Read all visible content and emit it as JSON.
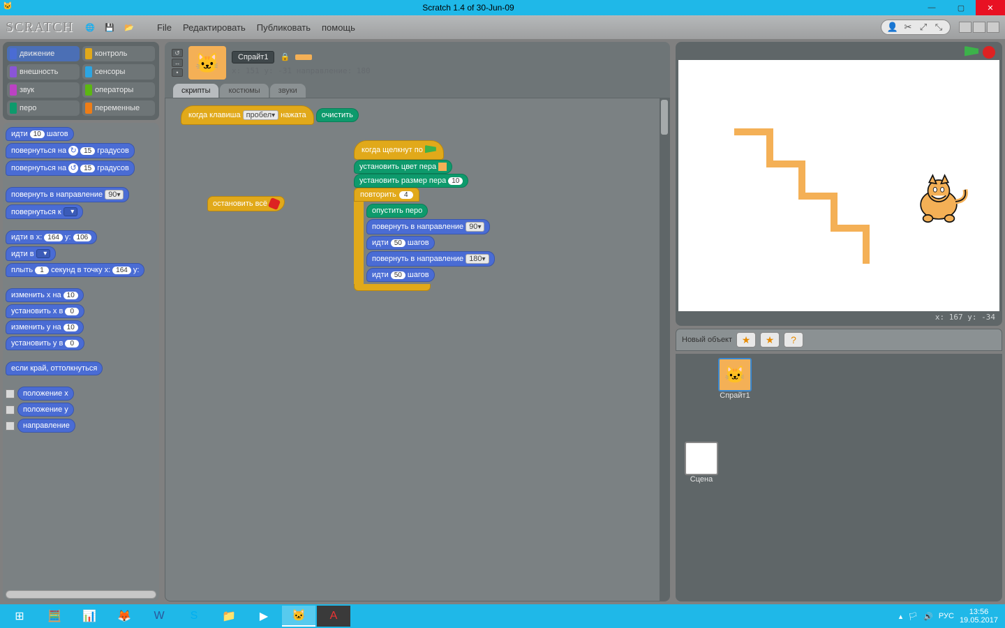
{
  "window": {
    "title": "Scratch 1.4 of 30-Jun-09"
  },
  "menu": {
    "logo": "SCRATCH",
    "items": {
      "file": "File",
      "edit": "Редактировать",
      "share": "Публиковать",
      "help": "помощь"
    }
  },
  "categories": {
    "motion": "движение",
    "looks": "внешность",
    "sound": "звук",
    "pen": "перо",
    "control": "контроль",
    "sensing": "сенсоры",
    "operators": "операторы",
    "variables": "переменные",
    "colors": {
      "motion": "#4a6cd4",
      "looks": "#8a55d7",
      "sound": "#bb42c3",
      "pen": "#0e9a6c",
      "control": "#e1a91a",
      "sensing": "#2ca5e2",
      "operators": "#5cb712",
      "variables": "#ee7d16"
    }
  },
  "palette": {
    "move": {
      "a": "идти",
      "n": "10",
      "b": "шагов"
    },
    "turnCW": {
      "a": "повернуться на",
      "n": "15",
      "b": "градусов"
    },
    "turnCCW": {
      "a": "повернуться на",
      "n": "15",
      "b": "градусов"
    },
    "point": {
      "a": "повернуть в направление",
      "n": "90"
    },
    "pointTowards": {
      "a": "повернуться к",
      "n": " "
    },
    "gotoXY": {
      "a": "идти в x:",
      "x": "164",
      "b": "y:",
      "y": "106"
    },
    "goto": {
      "a": "идти в",
      "n": " "
    },
    "glide": {
      "a": "плыть",
      "s": "1",
      "b": "секунд в точку x:",
      "x": "164",
      "c": "y:"
    },
    "changeX": {
      "a": "изменить x на",
      "n": "10"
    },
    "setX": {
      "a": "установить x в",
      "n": "0"
    },
    "changeY": {
      "a": "изменить y на",
      "n": "10"
    },
    "setY": {
      "a": "установить y в",
      "n": "0"
    },
    "bounce": "если край, оттолкнуться",
    "rep_xpos": "положение x",
    "rep_ypos": "положение y",
    "rep_dir": "направление"
  },
  "sprite": {
    "name": "Спрайт1",
    "info": "x: 151  y: -31  направление: 180",
    "tabs": {
      "scripts": "скрипты",
      "costumes": "костюмы",
      "sounds": "звуки"
    }
  },
  "scripts": {
    "s1": {
      "hat": {
        "a": "когда клавиша",
        "key": "пробел",
        "b": "нажата"
      },
      "clear": "очистить"
    },
    "s2": {
      "stopAll": "остановить всё"
    },
    "s3": {
      "hat": "когда щелкнут по",
      "setColor": "установить цвет пера",
      "setSize": {
        "a": "установить размер пера",
        "n": "10"
      },
      "repeat": {
        "a": "повторить",
        "n": "4"
      },
      "penDown": "опустить перо",
      "point1": {
        "a": "повернуть в направление",
        "n": "90"
      },
      "move1": {
        "a": "идти",
        "n": "50",
        "b": "шагов"
      },
      "point2": {
        "a": "повернуть в направление",
        "n": "180"
      },
      "move2": {
        "a": "идти",
        "n": "50",
        "b": "шагов"
      }
    }
  },
  "stage": {
    "xy": "x: 167   y: -34"
  },
  "newObject": {
    "label": "Новый объект"
  },
  "spriteList": {
    "sprite1": "Спрайт1",
    "scene": "Сцена"
  },
  "taskbar": {
    "lang": "РУС",
    "time": "13:56",
    "date": "19.05.2017"
  }
}
